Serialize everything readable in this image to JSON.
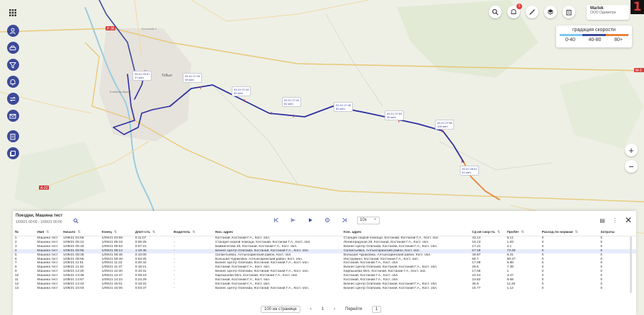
{
  "map": {
    "road_labels": [
      "Р-36",
      "А-22",
      "М-3",
      "Костанай-2"
    ],
    "city_label": "Тобыл",
    "airport_label": "Kostanay Airport",
    "markers": [
      {
        "time": "09-01 05:47",
        "speed": "37 км/ч"
      },
      {
        "time": "09-01 07:26",
        "speed": "48 км/ч"
      },
      {
        "time": "09-01 07:44",
        "speed": "82 км/ч"
      },
      {
        "time": "09-01 07:44",
        "speed": "82 км/ч"
      },
      {
        "time": "09-01 07:48",
        "speed": "85 км/ч"
      },
      {
        "time": "09-01 07:53",
        "speed": "96 км/ч"
      },
      {
        "time": "09-01 07:58",
        "speed": "106 км/ч"
      },
      {
        "time": "09-01 08:01",
        "speed": "81 км/ч"
      }
    ]
  },
  "sidebar": {
    "items": [
      "grid-icon",
      "user-icon",
      "car-icon",
      "filter-icon",
      "bell-icon",
      "swap-icon",
      "mail-icon",
      "clipboard-icon",
      "layers-icon"
    ]
  },
  "header": {
    "notifications_count": "0",
    "user_name": "Marlek",
    "user_org": "ООО Одометрн",
    "logo_char": "1"
  },
  "speed_legend": {
    "title": "градация скорости",
    "ranges": [
      "0-40",
      "40-80",
      "80+"
    ],
    "colors": [
      "#7cc8f0",
      "#3c4a99",
      "#e8833a"
    ]
  },
  "panel": {
    "title": "Поездки, Машина тест",
    "subtitle": "1/09/21 00:00 - 1/09/21 00:00",
    "speed_value": "10x",
    "columns": [
      "№",
      "Имя",
      "Начало",
      "Конец",
      "Длит-сть",
      "Водитель",
      "Нач. адрес",
      "Кон. адрес",
      "Ср.ня скор-ть",
      "Пробег",
      "Расход по нормам",
      "Затраты"
    ],
    "rows": [
      [
        "1",
        "Машина тест",
        "1/09/21 04:56",
        "1/09/21 04:56",
        "0:11:07",
        "-",
        "Костанай, Костанай Г.А., Кост. обл.",
        "Станция скорой помощи, Костанай, Костанай Г.А., Кост. обл.",
        "43.14",
        "8.11",
        "0",
        "0"
      ],
      [
        "2",
        "Машина тест",
        "1/09/21 05:12",
        "1/09/21 05:18",
        "0:06:25",
        "-",
        "Станция скорой помощи, Костанай, Костанай Г.А., Кост. обл.",
        "Ленинградская 28, Костанай, Костанай Г.А., Кост. обл.",
        "18.13",
        "1.93",
        "0",
        "0"
      ],
      [
        "3",
        "Машина тест",
        "1/09/21 05:45",
        "1/09/21 05:53",
        "0:07:21",
        "-",
        "Байжигитова 30, Костанай, Костанай Г.А., Кост. обл.",
        "Бизнес Центр Gramada, Костанай, Костанай Г.А., Кост. обл.",
        "17.21",
        "2.1",
        "0",
        "0"
      ],
      [
        "4",
        "Машина тест",
        "1/09/21 06:55",
        "1/09/21 08:12",
        "1:16:46",
        "-",
        "Бизнес Центр Gramada, Костанай, Костанай Г.А., Кост. обл.",
        "Силантьевка, Алтынсаринский район, Кост. обл.",
        "57.28",
        "73.26",
        "0",
        "0"
      ],
      [
        "5",
        "Машина тест",
        "1/09/21 08:36",
        "1/09/21 08:46",
        "0:10:09",
        "-",
        "Силантьевка, Алтынсаринский район, Кост. обл.",
        "Большая Чураковка, Алтынсаринский район, Кост. обл.",
        "49.87",
        "8.31",
        "0",
        "0"
      ],
      [
        "6",
        "Машина тест",
        "1/09/21 08:55",
        "1/09/21 09:48",
        "0:53:25",
        "-",
        "Большая Чураковка, Алтынсаринский район, Кост. обл.",
        "Инструмент, Костанай, Костанай Г.А., Кост. обл.",
        "66.7",
        "59.37",
        "0",
        "0"
      ],
      [
        "7",
        "Машина тест",
        "1/09/21 11:01",
        "1/09/21 11:22",
        "0:20:44",
        "-",
        "Бизнес Центр Gramada, Костанай, Костанай Г.А., Кост. обл.",
        "Костанай, Костанай Г.А., Кост. обл.",
        "17.08",
        "5.88",
        "0",
        "0"
      ],
      [
        "8",
        "Машина тест",
        "1/09/21 11:32",
        "1/09/21 11:47",
        "0:15:21",
        "-",
        "Костанай, Костанай Г.А., Кост. обл.",
        "Бизнес Центр Gramada, Костанай, Костанай Г.А., Кост. обл.",
        "28.5",
        "7.39",
        "0",
        "0"
      ],
      [
        "9",
        "Машина тест",
        "1/09/21 12:20",
        "1/09/21 12:30",
        "0:10:31",
        "-",
        "Бизнес Центр Gramada, Костанай, Костанай Г.А., Кост. обл.",
        "Карбышева 55/1, Костанай, Костанай Г.А., Кост. обл.",
        "17.06",
        "1",
        "0",
        "0"
      ],
      [
        "10",
        "Машина тест",
        "1/09/21 13:38",
        "1/09/21 13:47",
        "0:09:19",
        "-",
        "Карбышева 55/1, Костанай, Костанай Г.А., Кост. обл.",
        "Костанай, Костанай Г.А., Кост. обл.",
        "22.44",
        "3.47",
        "0",
        "0"
      ],
      [
        "11",
        "Машина тест",
        "1/09/21 13:57",
        "1/09/21 14:22",
        "0:24:29",
        "-",
        "Костанай, Костанай Г.А., Кост. обл.",
        "Костанай, Костанай Г.А., Кост. обл.",
        "23.82",
        "9.68",
        "0",
        "0"
      ],
      [
        "12",
        "Машина тест",
        "1/09/21 14:43",
        "1/09/21 15:01",
        "0:18:31",
        "-",
        "Костанай, Костанай Г.А., Кост. обл.",
        "Бизнес Центр Gramada, Костанай, Костанай Г.А., Кост. обл.",
        "35.9",
        "11.26",
        "0",
        "0"
      ],
      [
        "13",
        "Машина тест",
        "1/09/21 15:03",
        "1/09/21 15:06",
        "0:03:47",
        "-",
        "Бизнес Центр Gramada, Костанай, Костанай Г.А., Кост. обл.",
        "Бизнес Центр Gramada, Костанай, Костанай Г.А., Кост. обл.",
        "16.77",
        "1.12",
        "0",
        "0"
      ]
    ],
    "pager": {
      "page_size": "100 на странице",
      "current_page": "1",
      "goto_label": "Перейти",
      "goto_value": "1"
    }
  }
}
